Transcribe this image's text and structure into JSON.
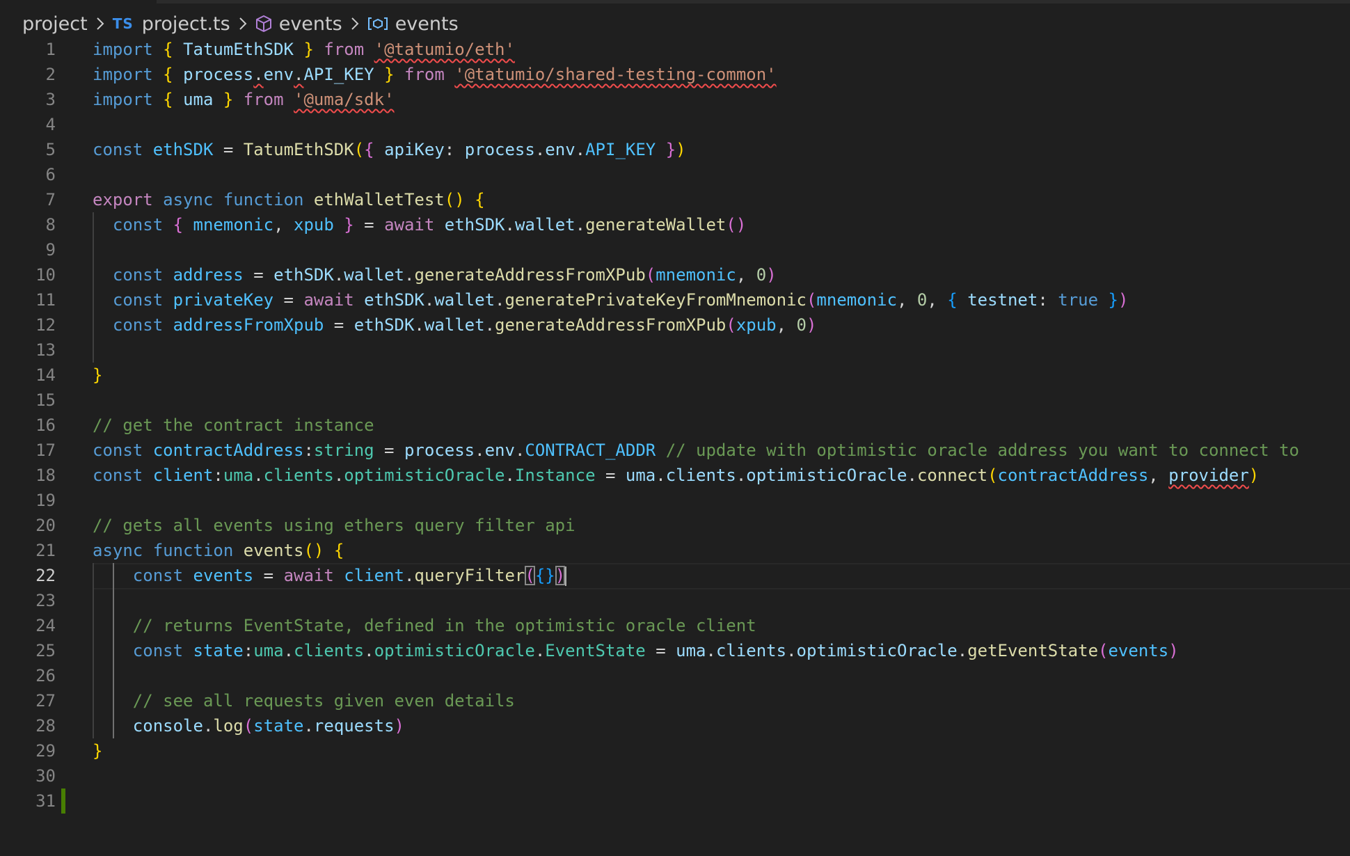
{
  "breadcrumb": {
    "items": [
      {
        "label": "project",
        "icon": null
      },
      {
        "label": "project.ts",
        "icon": "typescript-badge",
        "badge": "TS"
      },
      {
        "label": "events",
        "icon": "module-box-icon"
      },
      {
        "label": "events",
        "icon": "symbol-variable-icon"
      }
    ]
  },
  "editor": {
    "active_line": 22,
    "colors": {
      "background": "#1f1f1f",
      "keyword": "#569cd6",
      "control": "#c586c0",
      "variable": "#9cdcfe",
      "function": "#dcdcaa",
      "string": "#ce9178",
      "comment": "#6a9955",
      "type": "#4ec9b0",
      "error_squiggle": "#f14c4c",
      "git_added": "#487e02"
    },
    "lines": [
      {
        "n": "1",
        "tokens": [
          [
            "kw",
            "import"
          ],
          [
            "plain",
            " "
          ],
          [
            "b1",
            "{"
          ],
          [
            "plain",
            " "
          ],
          [
            "var",
            "TatumEthSDK"
          ],
          [
            "plain",
            " "
          ],
          [
            "b1",
            "}"
          ],
          [
            "plain",
            " "
          ],
          [
            "ctrl",
            "from"
          ],
          [
            "plain",
            " "
          ],
          [
            "str-err",
            "'@tatumio/eth'"
          ]
        ]
      },
      {
        "n": "2",
        "tokens": [
          [
            "kw",
            "import"
          ],
          [
            "plain",
            " "
          ],
          [
            "b1",
            "{"
          ],
          [
            "plain",
            " "
          ],
          [
            "var",
            "process"
          ],
          [
            "plain-err",
            "."
          ],
          [
            "var",
            "env"
          ],
          [
            "plain-err",
            "."
          ],
          [
            "var",
            "API_KEY"
          ],
          [
            "plain",
            " "
          ],
          [
            "b1",
            "}"
          ],
          [
            "plain",
            " "
          ],
          [
            "ctrl",
            "from"
          ],
          [
            "plain",
            " "
          ],
          [
            "str-err",
            "'@tatumio/shared-testing-common'"
          ]
        ]
      },
      {
        "n": "3",
        "tokens": [
          [
            "kw",
            "import"
          ],
          [
            "plain",
            " "
          ],
          [
            "b1",
            "{"
          ],
          [
            "plain",
            " "
          ],
          [
            "var",
            "uma"
          ],
          [
            "plain",
            " "
          ],
          [
            "b1",
            "}"
          ],
          [
            "plain",
            " "
          ],
          [
            "ctrl",
            "from"
          ],
          [
            "plain",
            " "
          ],
          [
            "str-err",
            "'@uma/sdk'"
          ]
        ]
      },
      {
        "n": "4",
        "tokens": []
      },
      {
        "n": "5",
        "tokens": [
          [
            "kw",
            "const"
          ],
          [
            "plain",
            " "
          ],
          [
            "const",
            "ethSDK"
          ],
          [
            "plain",
            " = "
          ],
          [
            "fn",
            "TatumEthSDK"
          ],
          [
            "b1",
            "("
          ],
          [
            "b2",
            "{"
          ],
          [
            "plain",
            " "
          ],
          [
            "var",
            "apiKey"
          ],
          [
            "plain",
            ": "
          ],
          [
            "var",
            "process"
          ],
          [
            "plain",
            "."
          ],
          [
            "var",
            "env"
          ],
          [
            "plain",
            "."
          ],
          [
            "const",
            "API_KEY"
          ],
          [
            "plain",
            " "
          ],
          [
            "b2",
            "}"
          ],
          [
            "b1",
            ")"
          ]
        ]
      },
      {
        "n": "6",
        "tokens": []
      },
      {
        "n": "7",
        "tokens": [
          [
            "ctrl",
            "export"
          ],
          [
            "plain",
            " "
          ],
          [
            "kw",
            "async"
          ],
          [
            "plain",
            " "
          ],
          [
            "kw",
            "function"
          ],
          [
            "plain",
            " "
          ],
          [
            "fn",
            "ethWalletTest"
          ],
          [
            "b1",
            "()"
          ],
          [
            "plain",
            " "
          ],
          [
            "b1",
            "{"
          ]
        ]
      },
      {
        "n": "8",
        "tokens": [
          [
            "plain",
            "  "
          ],
          [
            "kw",
            "const"
          ],
          [
            "plain",
            " "
          ],
          [
            "b2",
            "{"
          ],
          [
            "plain",
            " "
          ],
          [
            "const",
            "mnemonic"
          ],
          [
            "plain",
            ", "
          ],
          [
            "const",
            "xpub"
          ],
          [
            "plain",
            " "
          ],
          [
            "b2",
            "}"
          ],
          [
            "plain",
            " = "
          ],
          [
            "ctrl",
            "await"
          ],
          [
            "plain",
            " "
          ],
          [
            "var",
            "ethSDK"
          ],
          [
            "plain",
            "."
          ],
          [
            "var",
            "wallet"
          ],
          [
            "plain",
            "."
          ],
          [
            "fn",
            "generateWallet"
          ],
          [
            "b2",
            "()"
          ]
        ]
      },
      {
        "n": "9",
        "tokens": []
      },
      {
        "n": "10",
        "tokens": [
          [
            "plain",
            "  "
          ],
          [
            "kw",
            "const"
          ],
          [
            "plain",
            " "
          ],
          [
            "const",
            "address"
          ],
          [
            "plain",
            " = "
          ],
          [
            "var",
            "ethSDK"
          ],
          [
            "plain",
            "."
          ],
          [
            "var",
            "wallet"
          ],
          [
            "plain",
            "."
          ],
          [
            "fn",
            "generateAddressFromXPub"
          ],
          [
            "b2",
            "("
          ],
          [
            "const",
            "mnemonic"
          ],
          [
            "plain",
            ", "
          ],
          [
            "num",
            "0"
          ],
          [
            "b2",
            ")"
          ]
        ]
      },
      {
        "n": "11",
        "tokens": [
          [
            "plain",
            "  "
          ],
          [
            "kw",
            "const"
          ],
          [
            "plain",
            " "
          ],
          [
            "const",
            "privateKey"
          ],
          [
            "plain",
            " = "
          ],
          [
            "ctrl",
            "await"
          ],
          [
            "plain",
            " "
          ],
          [
            "var",
            "ethSDK"
          ],
          [
            "plain",
            "."
          ],
          [
            "var",
            "wallet"
          ],
          [
            "plain",
            "."
          ],
          [
            "fn",
            "generatePrivateKeyFromMnemonic"
          ],
          [
            "b2",
            "("
          ],
          [
            "const",
            "mnemonic"
          ],
          [
            "plain",
            ", "
          ],
          [
            "num",
            "0"
          ],
          [
            "plain",
            ", "
          ],
          [
            "b3",
            "{"
          ],
          [
            "plain",
            " "
          ],
          [
            "var",
            "testnet"
          ],
          [
            "plain",
            ": "
          ],
          [
            "kw",
            "true"
          ],
          [
            "plain",
            " "
          ],
          [
            "b3",
            "}"
          ],
          [
            "b2",
            ")"
          ]
        ]
      },
      {
        "n": "12",
        "tokens": [
          [
            "plain",
            "  "
          ],
          [
            "kw",
            "const"
          ],
          [
            "plain",
            " "
          ],
          [
            "const",
            "addressFromXpub"
          ],
          [
            "plain",
            " = "
          ],
          [
            "var",
            "ethSDK"
          ],
          [
            "plain",
            "."
          ],
          [
            "var",
            "wallet"
          ],
          [
            "plain",
            "."
          ],
          [
            "fn",
            "generateAddressFromXPub"
          ],
          [
            "b2",
            "("
          ],
          [
            "const",
            "xpub"
          ],
          [
            "plain",
            ", "
          ],
          [
            "num",
            "0"
          ],
          [
            "b2",
            ")"
          ]
        ]
      },
      {
        "n": "13",
        "tokens": []
      },
      {
        "n": "14",
        "tokens": [
          [
            "b1",
            "}"
          ]
        ]
      },
      {
        "n": "15",
        "tokens": []
      },
      {
        "n": "16",
        "tokens": [
          [
            "cmt",
            "// get the contract instance"
          ]
        ]
      },
      {
        "n": "17",
        "tokens": [
          [
            "kw",
            "const"
          ],
          [
            "plain",
            " "
          ],
          [
            "const",
            "contractAddress"
          ],
          [
            "plain",
            ":"
          ],
          [
            "type",
            "string"
          ],
          [
            "plain",
            " = "
          ],
          [
            "var",
            "process"
          ],
          [
            "plain",
            "."
          ],
          [
            "var",
            "env"
          ],
          [
            "plain",
            "."
          ],
          [
            "const",
            "CONTRACT_ADDR"
          ],
          [
            "plain",
            " "
          ],
          [
            "cmt",
            "// update with optimistic oracle address you want to connect to"
          ]
        ]
      },
      {
        "n": "18",
        "tokens": [
          [
            "kw",
            "const"
          ],
          [
            "plain",
            " "
          ],
          [
            "const",
            "client"
          ],
          [
            "plain",
            ":"
          ],
          [
            "type",
            "uma"
          ],
          [
            "plain",
            "."
          ],
          [
            "type",
            "clients"
          ],
          [
            "plain",
            "."
          ],
          [
            "type",
            "optimisticOracle"
          ],
          [
            "plain",
            "."
          ],
          [
            "type",
            "Instance"
          ],
          [
            "plain",
            " = "
          ],
          [
            "var",
            "uma"
          ],
          [
            "plain",
            "."
          ],
          [
            "var",
            "clients"
          ],
          [
            "plain",
            "."
          ],
          [
            "var",
            "optimisticOracle"
          ],
          [
            "plain",
            "."
          ],
          [
            "fn",
            "connect"
          ],
          [
            "b1",
            "("
          ],
          [
            "const",
            "contractAddress"
          ],
          [
            "plain",
            ", "
          ],
          [
            "var-err",
            "provider"
          ],
          [
            "b1",
            ")"
          ]
        ]
      },
      {
        "n": "19",
        "tokens": []
      },
      {
        "n": "20",
        "tokens": [
          [
            "cmt",
            "// gets all events using ethers query filter api"
          ]
        ]
      },
      {
        "n": "21",
        "tokens": [
          [
            "kw",
            "async"
          ],
          [
            "plain",
            " "
          ],
          [
            "kw",
            "function"
          ],
          [
            "plain",
            " "
          ],
          [
            "fn",
            "events"
          ],
          [
            "b1",
            "()"
          ],
          [
            "plain",
            " "
          ],
          [
            "b1",
            "{"
          ]
        ]
      },
      {
        "n": "22",
        "tokens": [
          [
            "plain",
            "    "
          ],
          [
            "kw",
            "const"
          ],
          [
            "plain",
            " "
          ],
          [
            "const",
            "events"
          ],
          [
            "plain",
            " = "
          ],
          [
            "ctrl",
            "await"
          ],
          [
            "plain",
            " "
          ],
          [
            "const",
            "client"
          ],
          [
            "plain",
            "."
          ],
          [
            "fn",
            "queryFilter"
          ],
          [
            "b2-match",
            "("
          ],
          [
            "b3",
            "{}"
          ],
          [
            "b2-match",
            ")"
          ],
          [
            "cursor",
            ""
          ]
        ]
      },
      {
        "n": "23",
        "tokens": []
      },
      {
        "n": "24",
        "tokens": [
          [
            "plain",
            "    "
          ],
          [
            "cmt",
            "// returns EventState, defined in the optimistic oracle client"
          ]
        ]
      },
      {
        "n": "25",
        "tokens": [
          [
            "plain",
            "    "
          ],
          [
            "kw",
            "const"
          ],
          [
            "plain",
            " "
          ],
          [
            "const",
            "state"
          ],
          [
            "plain",
            ":"
          ],
          [
            "type",
            "uma"
          ],
          [
            "plain",
            "."
          ],
          [
            "type",
            "clients"
          ],
          [
            "plain",
            "."
          ],
          [
            "type",
            "optimisticOracle"
          ],
          [
            "plain",
            "."
          ],
          [
            "type",
            "EventState"
          ],
          [
            "plain",
            " = "
          ],
          [
            "var",
            "uma"
          ],
          [
            "plain",
            "."
          ],
          [
            "var",
            "clients"
          ],
          [
            "plain",
            "."
          ],
          [
            "var",
            "optimisticOracle"
          ],
          [
            "plain",
            "."
          ],
          [
            "fn",
            "getEventState"
          ],
          [
            "b2",
            "("
          ],
          [
            "const",
            "events"
          ],
          [
            "b2",
            ")"
          ]
        ]
      },
      {
        "n": "26",
        "tokens": []
      },
      {
        "n": "27",
        "tokens": [
          [
            "plain",
            "    "
          ],
          [
            "cmt",
            "// see all requests given even details"
          ]
        ]
      },
      {
        "n": "28",
        "tokens": [
          [
            "plain",
            "    "
          ],
          [
            "var",
            "console"
          ],
          [
            "plain",
            "."
          ],
          [
            "fn",
            "log"
          ],
          [
            "b2",
            "("
          ],
          [
            "const",
            "state"
          ],
          [
            "plain",
            "."
          ],
          [
            "var",
            "requests"
          ],
          [
            "b2",
            ")"
          ]
        ]
      },
      {
        "n": "29",
        "tokens": [
          [
            "b1",
            "}"
          ]
        ]
      },
      {
        "n": "30",
        "tokens": []
      },
      {
        "n": "31",
        "tokens": []
      }
    ]
  }
}
